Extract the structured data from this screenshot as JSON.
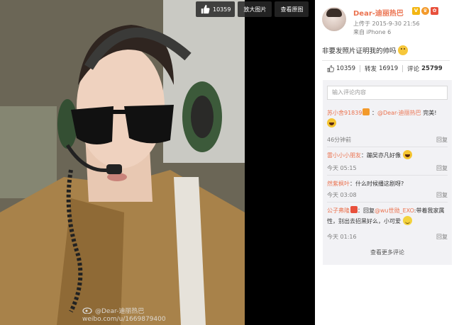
{
  "toolbar": {
    "like_count": "10359",
    "enlarge_label": "放大图片",
    "original_label": "查看原图"
  },
  "watermark": {
    "line1": "@Dear-迪丽热巴",
    "line2": "weibo.com/u/1669879400"
  },
  "post": {
    "username": "Dear-迪丽热巴",
    "upload_time": "上传于 2015-9-30 21:56",
    "upload_device": "来自 iPhone 6",
    "text": "非要发照片证明我的帅吗"
  },
  "stats": {
    "likes": "10359",
    "repost_label": "转发",
    "reposts": "16919",
    "comment_label": "评论",
    "comments": "25799"
  },
  "comment_input": {
    "placeholder": "输入评论内容"
  },
  "comments": [
    {
      "user": "苏小舍91839",
      "mention": "@Dear-迪丽热巴",
      "text": " 完美!",
      "time": "46分钟前",
      "reply": "回复"
    },
    {
      "user": "雷小小小朋友",
      "text": "：蹦吴亦凡好像",
      "time": "今天 05:15",
      "reply": "回复"
    },
    {
      "user": "然紫枫叶",
      "text": "：什么时候播这剧呀?",
      "time": "今天 03:08",
      "reply": "回复"
    },
    {
      "user": "公子弗隆",
      "prefix": "：回复",
      "mention": "@wu世勋_EXO",
      "text": ":带着我家属性，别出去招黑好么，小可爱",
      "time": "今天 01:16",
      "reply": "回复"
    }
  ],
  "more_comments": "查看更多评论",
  "colors": {
    "accent": "#eb7350",
    "panel_bg": "#f2f2f5"
  }
}
